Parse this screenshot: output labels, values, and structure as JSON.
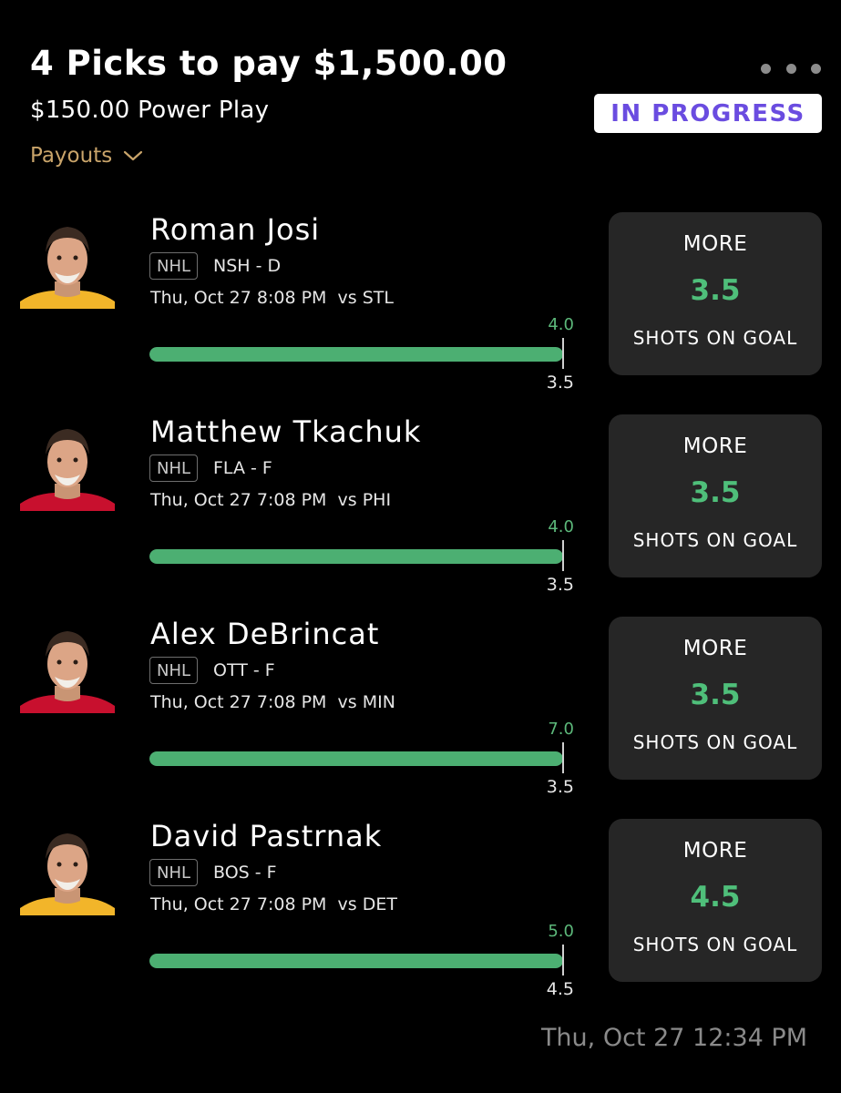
{
  "header": {
    "title": "4 Picks to pay $1,500.00",
    "subtitle": "$150.00 Power Play",
    "payouts_label": "Payouts",
    "status": "IN PROGRESS",
    "menu_icon": "more-horizontal-icon",
    "payouts_icon": "chevron-down-icon"
  },
  "colors": {
    "accent_green": "#4caf72",
    "status_purple": "#6a4ce0",
    "payouts_gold": "#c9a46a",
    "card_bg": "#262626"
  },
  "picks": [
    {
      "player": "Roman Josi",
      "league": "NHL",
      "team_pos": "NSH - D",
      "game": "Thu, Oct 27 8:08 PM  vs STL",
      "actual": "4.0",
      "line": "3.5",
      "progress": 1.0,
      "direction": "MORE",
      "prop_line": "3.5",
      "stat": "SHOTS ON GOAL",
      "jersey": "#f2b52a"
    },
    {
      "player": "Matthew Tkachuk",
      "league": "NHL",
      "team_pos": "FLA - F",
      "game": "Thu, Oct 27 7:08 PM  vs PHI",
      "actual": "4.0",
      "line": "3.5",
      "progress": 1.0,
      "direction": "MORE",
      "prop_line": "3.5",
      "stat": "SHOTS ON GOAL",
      "jersey": "#c8102e"
    },
    {
      "player": "Alex DeBrincat",
      "league": "NHL",
      "team_pos": "OTT - F",
      "game": "Thu, Oct 27 7:08 PM  vs MIN",
      "actual": "7.0",
      "line": "3.5",
      "progress": 1.0,
      "direction": "MORE",
      "prop_line": "3.5",
      "stat": "SHOTS ON GOAL",
      "jersey": "#c8102e"
    },
    {
      "player": "David Pastrnak",
      "league": "NHL",
      "team_pos": "BOS - F",
      "game": "Thu, Oct 27 7:08 PM  vs DET",
      "actual": "5.0",
      "line": "4.5",
      "progress": 1.0,
      "direction": "MORE",
      "prop_line": "4.5",
      "stat": "SHOTS ON GOAL",
      "jersey": "#f2b52a"
    }
  ],
  "footer": {
    "timestamp": "Thu, Oct 27 12:34 PM"
  }
}
